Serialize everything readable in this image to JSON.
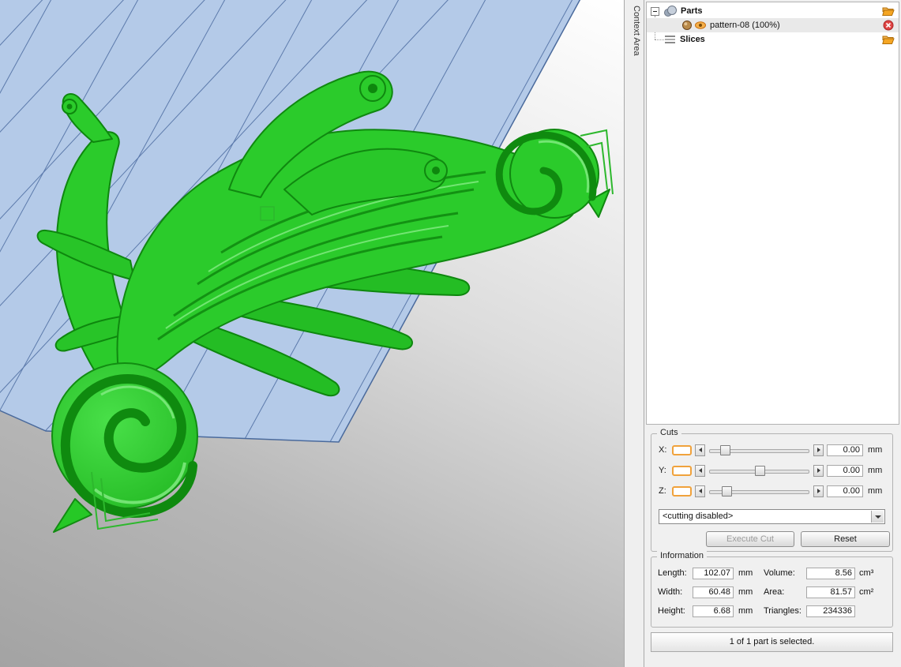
{
  "window": {
    "context_area_label": "Context Area"
  },
  "colors": {
    "accent_orange": "#f0a23c",
    "selection_green": "#2db82d",
    "model_green": "#2bcb2b",
    "platform_blue": "#b4cae8",
    "grid_line_blue": "#5c7aab"
  },
  "tree": {
    "parts_label": "Parts",
    "part_item_label": "pattern-08 (100%)",
    "slices_label": "Slices"
  },
  "cuts": {
    "title": "Cuts",
    "rows": [
      {
        "axis": "X:",
        "value": "0.00",
        "unit": "mm"
      },
      {
        "axis": "Y:",
        "value": "0.00",
        "unit": "mm"
      },
      {
        "axis": "Z:",
        "value": "0.00",
        "unit": "mm"
      }
    ],
    "mode_selected": "<cutting disabled>",
    "execute_label": "Execute Cut",
    "reset_label": "Reset"
  },
  "information": {
    "title": "Information",
    "left": [
      {
        "label": "Length:",
        "value": "102.07",
        "unit": "mm"
      },
      {
        "label": "Width:",
        "value": "60.48",
        "unit": "mm"
      },
      {
        "label": "Height:",
        "value": "6.68",
        "unit": "mm"
      }
    ],
    "right": [
      {
        "label": "Volume:",
        "value": "8.56",
        "unit": "cm³"
      },
      {
        "label": "Area:",
        "value": "81.57",
        "unit": "cm²"
      },
      {
        "label": "Triangles:",
        "value": "234336",
        "unit": ""
      }
    ]
  },
  "status": {
    "text": "1 of 1 part is selected."
  }
}
